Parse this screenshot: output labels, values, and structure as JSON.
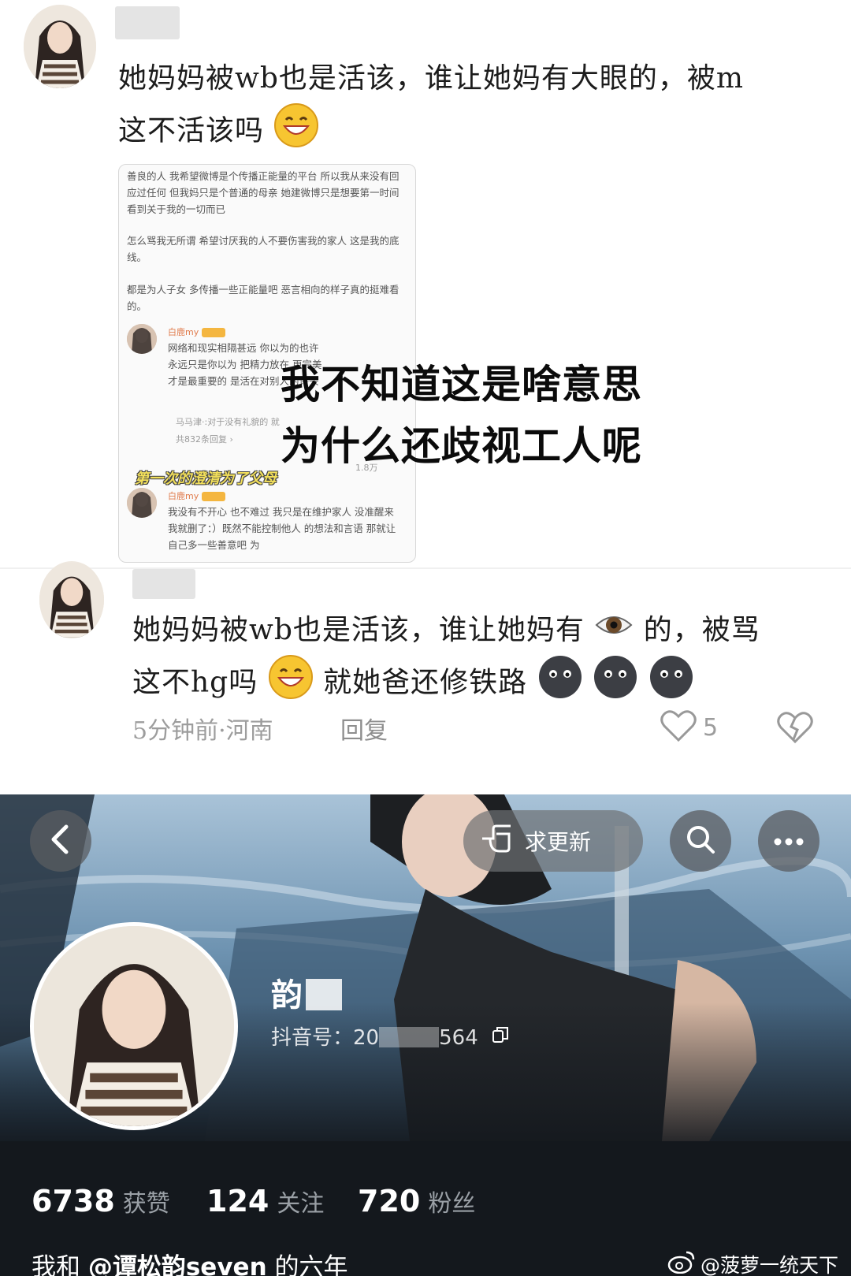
{
  "comment1": {
    "text_line1": "她妈妈被wb也是活该，谁让她妈有大眼的，被m",
    "text_line2": "这不活该吗",
    "inner_screenshot": {
      "para1": "善良的人 我希望微博是个传播正能量的平台 所以我从来没有回应过任何 但我妈只是个普通的母亲 她建微博只是想要第一时间看到关于我的一切而已",
      "para2": "怎么骂我无所谓 希望讨厌我的人不要伤害我的家人 这是我的底线。",
      "para3": "都是为人子女 多传播一些正能量吧 恶言相向的样子真的挺难看的。",
      "reply1_name": "白鹿my",
      "reply1_text": "网络和现实相隔甚远 你以为的也许永远只是你以为 把精力放在 更完美才是最重要的 是活在对别人的评头",
      "reply1_sub": "马马津·:对于没有礼貌的 就",
      "reply1_count": "共832条回复 ›",
      "caption": "第一次的澄清为了父母",
      "likes": "1.8万",
      "reply2_name": "白鹿my",
      "reply2_text": "我没有不开心 也不难过 我只是在维护家人 没准醒来我就删了：）既然不能控制他人 的想法和言语 那就让自己多一些善意吧 为"
    },
    "overlay_line1": "我不知道这是啥意思",
    "overlay_line2": "为什么还歧视工人呢"
  },
  "comment2": {
    "text_line1_a": "她妈妈被wb也是活该，谁让她妈有",
    "text_line1_b": "的，被骂",
    "text_line2_a": "这不hg吗",
    "text_line2_b": "就她爸还修铁路",
    "time_location": "5分钟前·河南",
    "reply_label": "回复",
    "like_count": "5"
  },
  "profile": {
    "update_button": "求更新",
    "name": "韵",
    "douyin_id_label": "抖音号：",
    "douyin_id_visible_start": "20",
    "douyin_id_visible_end": "564",
    "stats": [
      {
        "num": "6738",
        "label": "获赞"
      },
      {
        "num": "124",
        "label": "关注"
      },
      {
        "num": "720",
        "label": "粉丝"
      }
    ],
    "bio_prefix": "我和",
    "bio_mention": "@谭松韵seven",
    "bio_suffix": "的六年",
    "watermark": "@菠萝一统天下"
  },
  "colors": {
    "accent_yellow": "#f2df5b",
    "like_tag": "#f4b640",
    "profile_dark": "#14181d",
    "meta_gray": "#9d9d9d"
  },
  "icons": [
    "back-icon",
    "hand-point-icon",
    "search-icon",
    "more-icon",
    "heart-icon",
    "broken-heart-icon",
    "copy-icon",
    "weibo-logo-icon",
    "eye-emoji",
    "grin-emoji",
    "dark-face-emoji"
  ]
}
